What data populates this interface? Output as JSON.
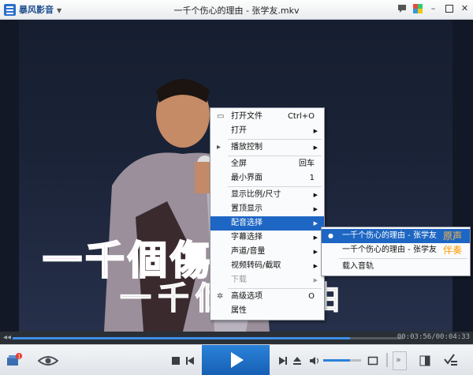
{
  "app": {
    "name": "暴风影音",
    "title": "一千个伤心的理由 - 张学友.mkv"
  },
  "video": {
    "lyric_top": "一千個傷心",
    "lyric_bottom": "一千個的理由"
  },
  "playback": {
    "time": "00:03:56/00:04:33",
    "progress": 0.865,
    "volume": 0.7
  },
  "context_menu": [
    {
      "label": "打开文件",
      "shortcut": "Ctrl+O",
      "icon": "open-file-icon"
    },
    {
      "label": "打开",
      "submenu": true
    },
    {
      "separator": true
    },
    {
      "label": "播放控制",
      "submenu": true,
      "icon": "play-control-icon"
    },
    {
      "separator": true
    },
    {
      "label": "全屏",
      "shortcut": "回车"
    },
    {
      "label": "最小界面",
      "shortcut": "1"
    },
    {
      "separator": true
    },
    {
      "label": "显示比例/尺寸",
      "submenu": true
    },
    {
      "label": "置顶显示",
      "submenu": true
    },
    {
      "label": "配音选择",
      "submenu": true,
      "highlighted": true
    },
    {
      "label": "字幕选择",
      "submenu": true
    },
    {
      "label": "声道/音量",
      "submenu": true
    },
    {
      "label": "视频转码/截取",
      "submenu": true
    },
    {
      "label": "下载",
      "submenu": true,
      "disabled": true
    },
    {
      "separator": true
    },
    {
      "label": "高级选项",
      "shortcut": "O",
      "icon": "gear-icon"
    },
    {
      "label": "属性"
    }
  ],
  "audio_submenu": {
    "track1": {
      "label": "一千个伤心的理由 - 张学友",
      "tag": "原声"
    },
    "track2": {
      "label": "一千个伤心的理由 - 张学友",
      "tag": "伴奏"
    },
    "load": "载入音轨"
  },
  "colors": {
    "accent": "#1e66c3",
    "tag": "#ff9900",
    "play_button": "#1f6fc6"
  }
}
